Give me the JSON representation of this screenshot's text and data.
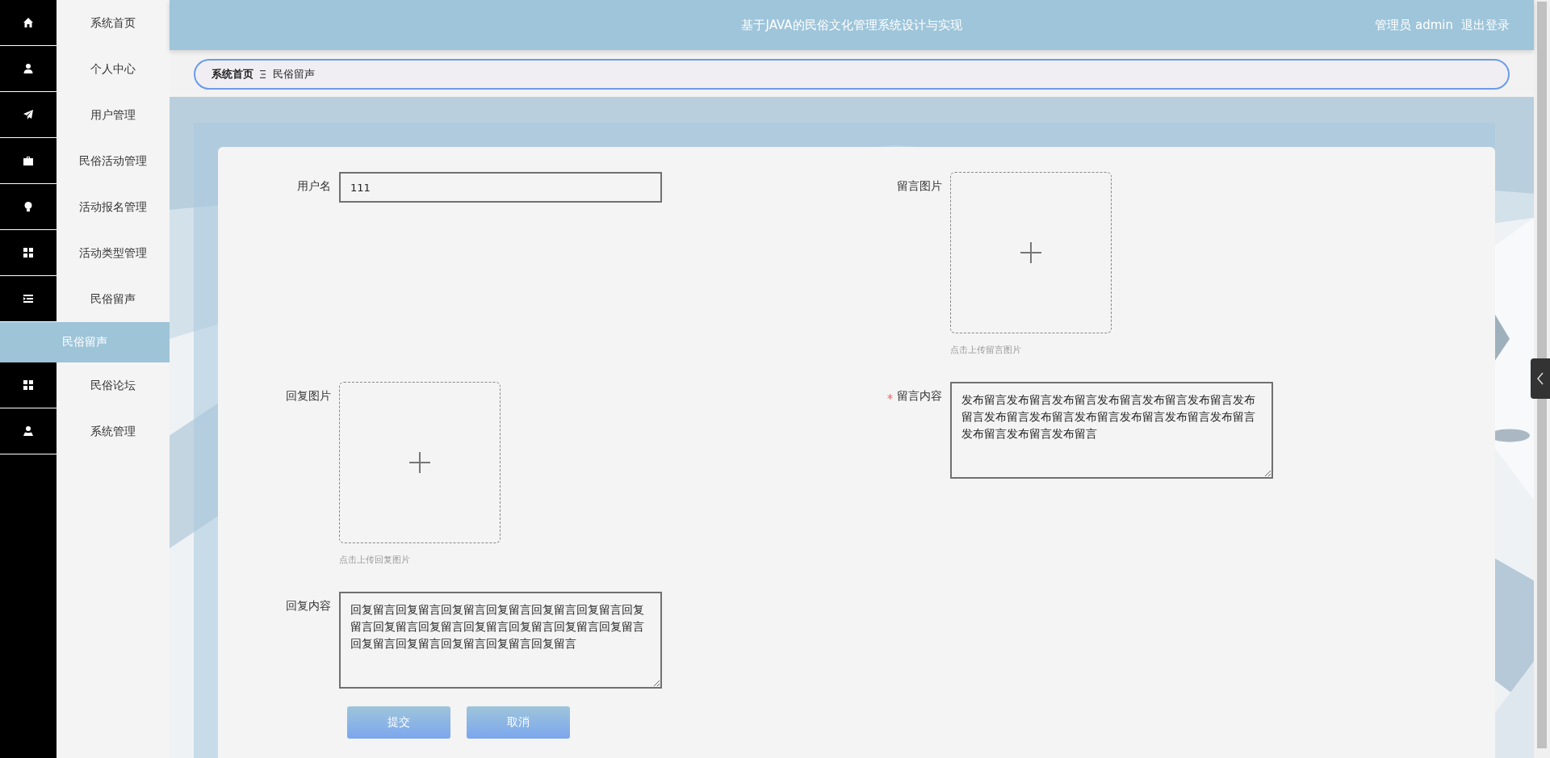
{
  "sidebar": {
    "items": [
      {
        "label": "系统首页",
        "selected": false
      },
      {
        "label": "个人中心",
        "selected": false
      },
      {
        "label": "用户管理",
        "selected": false
      },
      {
        "label": "民俗活动管理",
        "selected": false
      },
      {
        "label": "活动报名管理",
        "selected": false
      },
      {
        "label": "活动类型管理",
        "selected": false
      },
      {
        "label": "民俗留声",
        "selected": false,
        "expanded": true,
        "children": [
          {
            "label": "民俗留声",
            "selected": true
          }
        ]
      },
      {
        "label": "民俗论坛",
        "selected": false
      },
      {
        "label": "系统管理",
        "selected": false
      }
    ]
  },
  "header": {
    "title": "基于JAVA的民俗文化管理系统设计与实现",
    "user": "管理员 admin",
    "logout": "退出登录"
  },
  "breadcrumb": [
    {
      "label": "系统首页"
    },
    {
      "label": "民俗留声"
    }
  ],
  "form": {
    "fields": [
      {
        "kind": "input",
        "label": "用户名",
        "value": "111",
        "required": false
      },
      {
        "kind": "upload",
        "label": "留言图片",
        "hint": "点击上传留言图片",
        "required": false
      },
      {
        "kind": "upload",
        "label": "回复图片",
        "hint": "点击上传回复图片",
        "required": false
      },
      {
        "kind": "textarea",
        "label": "留言内容",
        "value": "发布留言发布留言发布留言发布留言发布留言发布留言发布留言发布留言发布留言发布留言发布留言发布留言发布留言发布留言发布留言发布留言",
        "required": true
      },
      {
        "kind": "textarea",
        "label": "回复内容",
        "value": "回复留言回复留言回复留言回复留言回复留言回复留言回复留言回复留言回复留言回复留言回复留言回复留言回复留言回复留言回复留言回复留言回复留言回复留言",
        "required": false
      }
    ],
    "buttons": [
      {
        "label": "提交"
      },
      {
        "label": "取消"
      }
    ]
  }
}
